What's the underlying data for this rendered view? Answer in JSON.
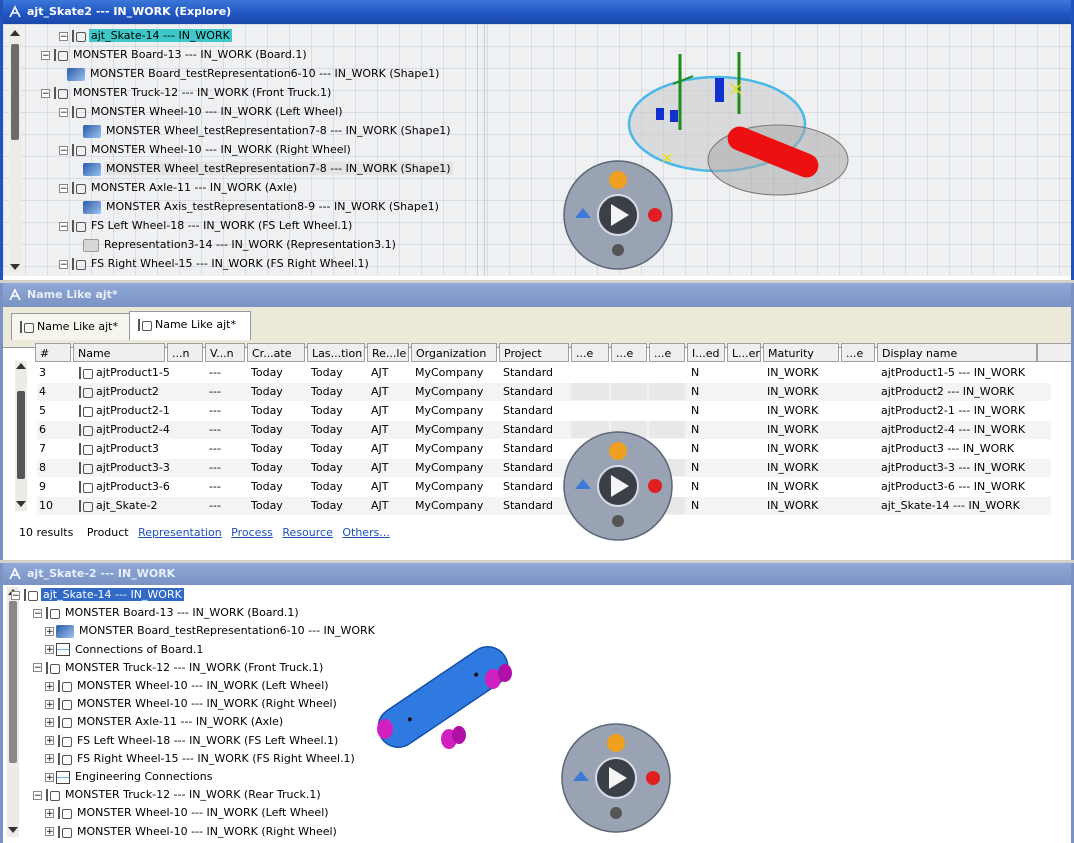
{
  "window1": {
    "title": "ajt_Skate2 --- IN_WORK (Explore)",
    "tree": [
      {
        "label": "ajt_Skate-14 --- IN_WORK",
        "icon": "product-icon",
        "state": "selected-cyan"
      },
      {
        "label": "MONSTER Board-13 --- IN_WORK (Board.1)",
        "icon": "product-icon"
      },
      {
        "label": "MONSTER Board_testRepresentation6-10 --- IN_WORK (Shape1)",
        "icon": "shape-icon"
      },
      {
        "label": "MONSTER Truck-12 --- IN_WORK (Front Truck.1)",
        "icon": "product-icon"
      },
      {
        "label": "MONSTER Wheel-10 --- IN_WORK (Left Wheel)",
        "icon": "product-icon"
      },
      {
        "label": "MONSTER Wheel_testRepresentation7-8 --- IN_WORK (Shape1)",
        "icon": "shape-icon"
      },
      {
        "label": "MONSTER Wheel-10 --- IN_WORK (Right Wheel)",
        "icon": "product-icon"
      },
      {
        "label": "MONSTER Wheel_testRepresentation7-8 --- IN_WORK (Shape1)",
        "icon": "shape-icon",
        "state": "selected-grey"
      },
      {
        "label": "MONSTER Axle-11 --- IN_WORK (Axle)",
        "icon": "product-icon"
      },
      {
        "label": "MONSTER Axis_testRepresentation8-9 --- IN_WORK (Shape1)",
        "icon": "shape-icon"
      },
      {
        "label": "FS Left Wheel-18 --- IN_WORK (FS Left Wheel.1)",
        "icon": "product-icon"
      },
      {
        "label": "Representation3-14 --- IN_WORK (Representation3.1)",
        "icon": "representation-icon"
      },
      {
        "label": "FS Right Wheel-15 --- IN_WORK (FS Right Wheel.1)",
        "icon": "product-icon"
      }
    ]
  },
  "window2": {
    "title": "Name Like ajt*",
    "tabs": [
      "Name Like ajt*",
      "Name Like ajt*"
    ],
    "columns": [
      "#",
      "Name",
      "...n",
      "V...n",
      "Cr...ate",
      "Las...tion",
      "Re...le",
      "Organization",
      "Project",
      "...e",
      "...e",
      "...e",
      "I...ed",
      "L...er",
      "Maturity",
      "...e",
      "Display name"
    ],
    "rows": [
      [
        "3",
        "ajtProduct1-5",
        "",
        "---",
        "Today",
        "Today",
        "AJT",
        "MyCompany",
        "Standard",
        "",
        "",
        "",
        "N",
        "",
        "IN_WORK",
        "",
        "ajtProduct1-5 --- IN_WORK"
      ],
      [
        "4",
        "ajtProduct2",
        "",
        "---",
        "Today",
        "Today",
        "AJT",
        "MyCompany",
        "Standard",
        "",
        "",
        "",
        "N",
        "",
        "IN_WORK",
        "",
        "ajtProduct2 --- IN_WORK"
      ],
      [
        "5",
        "ajtProduct2-1",
        "",
        "---",
        "Today",
        "Today",
        "AJT",
        "MyCompany",
        "Standard",
        "",
        "",
        "",
        "N",
        "",
        "IN_WORK",
        "",
        "ajtProduct2-1 --- IN_WORK"
      ],
      [
        "6",
        "ajtProduct2-4",
        "",
        "---",
        "Today",
        "Today",
        "AJT",
        "MyCompany",
        "Standard",
        "",
        "",
        "",
        "N",
        "",
        "IN_WORK",
        "",
        "ajtProduct2-4 --- IN_WORK"
      ],
      [
        "7",
        "ajtProduct3",
        "",
        "---",
        "Today",
        "Today",
        "AJT",
        "MyCompany",
        "Standard",
        "",
        "",
        "",
        "N",
        "",
        "IN_WORK",
        "",
        "ajtProduct3 --- IN_WORK"
      ],
      [
        "8",
        "ajtProduct3-3",
        "",
        "---",
        "Today",
        "Today",
        "AJT",
        "MyCompany",
        "Standard",
        "",
        "",
        "",
        "N",
        "",
        "IN_WORK",
        "",
        "ajtProduct3-3 --- IN_WORK"
      ],
      [
        "9",
        "ajtProduct3-6",
        "",
        "---",
        "Today",
        "Today",
        "AJT",
        "MyCompany",
        "Standard",
        "",
        "",
        "",
        "N",
        "",
        "IN_WORK",
        "",
        "ajtProduct3-6 --- IN_WORK"
      ],
      [
        "10",
        "ajt_Skate-2",
        "",
        "---",
        "Today",
        "Today",
        "AJT",
        "MyCompany",
        "Standard",
        "",
        "",
        "",
        "N",
        "",
        "IN_WORK",
        "",
        "ajt_Skate-14 --- IN_WORK"
      ]
    ],
    "footer": {
      "count": "10 results",
      "active_filter": "Product",
      "links": [
        "Representation",
        "Process",
        "Resource",
        "Others..."
      ]
    }
  },
  "window3": {
    "title": "ajt_Skate-2 --- IN_WORK",
    "tree": [
      {
        "label": "ajt_Skate-14 --- IN_WORK",
        "icon": "product-icon",
        "state": "selected-blue"
      },
      {
        "label": "MONSTER Board-13 --- IN_WORK (Board.1)",
        "icon": "product-icon"
      },
      {
        "label": "MONSTER Board_testRepresentation6-10 --- IN_WORK",
        "icon": "shape-icon"
      },
      {
        "label": "Connections of Board.1",
        "icon": "connections-icon"
      },
      {
        "label": "MONSTER Truck-12 --- IN_WORK (Front Truck.1)",
        "icon": "product-icon"
      },
      {
        "label": "MONSTER Wheel-10 --- IN_WORK (Left Wheel)",
        "icon": "product-icon"
      },
      {
        "label": "MONSTER Wheel-10 --- IN_WORK (Right Wheel)",
        "icon": "product-icon"
      },
      {
        "label": "MONSTER Axle-11 --- IN_WORK (Axle)",
        "icon": "product-icon"
      },
      {
        "label": "FS Left Wheel-18 --- IN_WORK (FS Left Wheel.1)",
        "icon": "product-icon"
      },
      {
        "label": "FS Right Wheel-15 --- IN_WORK (FS Right Wheel.1)",
        "icon": "product-icon"
      },
      {
        "label": "Engineering Connections",
        "icon": "connections-icon"
      },
      {
        "label": "MONSTER Truck-12 --- IN_WORK (Rear Truck.1)",
        "icon": "product-icon"
      },
      {
        "label": "MONSTER Wheel-10 --- IN_WORK (Left Wheel)",
        "icon": "product-icon"
      },
      {
        "label": "MONSTER Wheel-10 --- IN_WORK (Right Wheel)",
        "icon": "product-icon"
      }
    ]
  },
  "colors": {
    "title_active": "#1f54c0",
    "title_inactive": "#7b93c4",
    "selection_cyan": "#40c8c8",
    "selection_blue": "#3169c6",
    "link": "#1c4fb4",
    "board_blue": "#2f7ae0",
    "wheel_magenta": "#d020c0",
    "deck_red": "#ee1010"
  }
}
